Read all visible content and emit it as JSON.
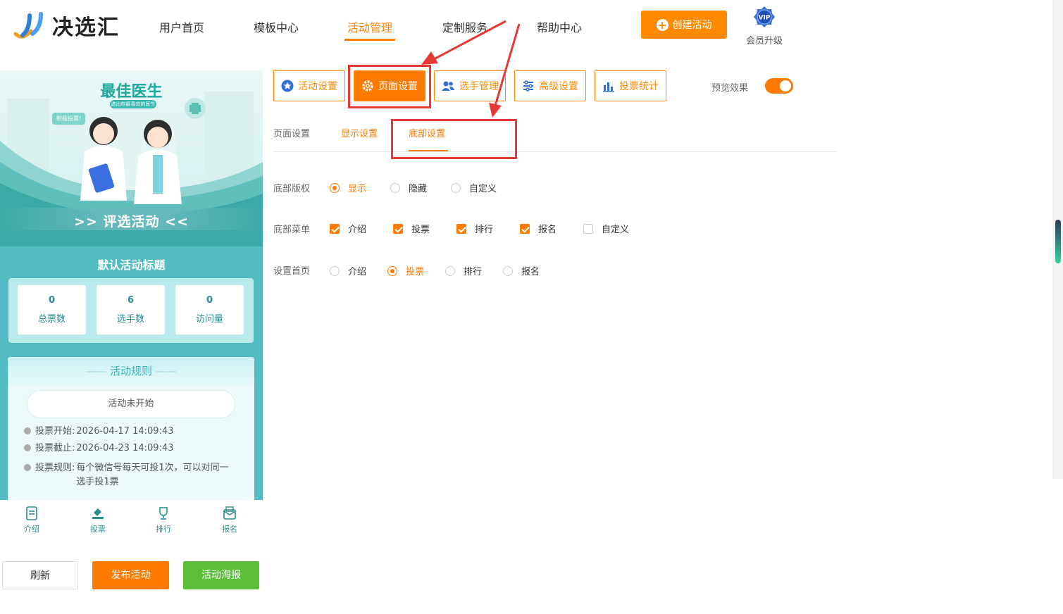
{
  "brand": {
    "name": "决选汇"
  },
  "nav": [
    {
      "label": "用户首页"
    },
    {
      "label": "模板中心"
    },
    {
      "label": "活动管理"
    },
    {
      "label": "定制服务"
    },
    {
      "label": "帮助中心"
    }
  ],
  "header": {
    "create_label": "创建活动",
    "vip_badge": "VIP",
    "vip_label": "会员升级"
  },
  "preview": {
    "banner_title": "最佳医生",
    "banner_subtitle": "选出你最喜欢的医生",
    "banner_bubble": "积极投票!",
    "banner_strip": ">> 评选活动 <<",
    "activity_title": "默认活动标题",
    "stats": [
      {
        "value": "0",
        "label": "总票数"
      },
      {
        "value": "6",
        "label": "选手数"
      },
      {
        "value": "0",
        "label": "访问量"
      }
    ],
    "rules_title": "活动规则",
    "status": "活动未开始",
    "rules": [
      {
        "key": "投票开始:",
        "value": "2026-04-17 14:09:43"
      },
      {
        "key": "投票截止:",
        "value": "2026-04-23 14:09:43"
      },
      {
        "key": "投票规则:",
        "value": "每个微信号每天可投1次，可以对同一选手投1票"
      }
    ],
    "tabbar": [
      {
        "label": "介绍",
        "icon": "document-icon"
      },
      {
        "label": "投票",
        "icon": "vote-icon"
      },
      {
        "label": "排行",
        "icon": "trophy-icon"
      },
      {
        "label": "报名",
        "icon": "mail-icon"
      }
    ]
  },
  "actions": {
    "refresh": "刷新",
    "publish": "发布活动",
    "poster": "活动海报"
  },
  "toolbar": [
    {
      "label": "活动设置",
      "icon": "star-icon"
    },
    {
      "label": "页面设置",
      "icon": "gear-icon"
    },
    {
      "label": "选手管理",
      "icon": "users-icon"
    },
    {
      "label": "高级设置",
      "icon": "sliders-icon"
    },
    {
      "label": "投票统计",
      "icon": "bar-chart-icon"
    }
  ],
  "preview_toggle": {
    "label": "预览效果",
    "on": true
  },
  "subtabs": [
    {
      "label": "页面设置"
    },
    {
      "label": "显示设置"
    },
    {
      "label": "底部设置"
    }
  ],
  "form": {
    "copyright": {
      "label": "底部版权",
      "options": [
        "显示",
        "隐藏",
        "自定义"
      ],
      "selected": "显示"
    },
    "menu": {
      "label": "底部菜单",
      "options": [
        "介绍",
        "投票",
        "排行",
        "报名",
        "自定义"
      ],
      "checked": [
        "介绍",
        "投票",
        "排行",
        "报名"
      ]
    },
    "home": {
      "label": "设置首页",
      "options": [
        "介绍",
        "投票",
        "排行",
        "报名"
      ],
      "selected": "投票"
    }
  },
  "colors": {
    "accent": "#ff7a00",
    "teal": "#52bcc2",
    "green": "#5cbf3a",
    "annotation": "#e53935"
  }
}
